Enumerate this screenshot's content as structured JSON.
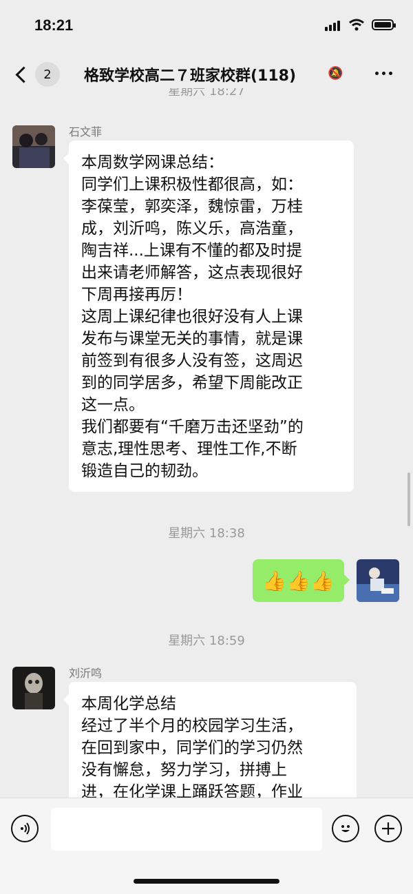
{
  "status_bar": {
    "time": "18:21"
  },
  "nav": {
    "back_count": "2",
    "title": "格致学校高二７班家校群(118)"
  },
  "timestamps": [
    "星期六 18:27",
    "星期六 18:38",
    "星期六 18:59"
  ],
  "messages": [
    {
      "sender": "石文菲",
      "lines": [
        "本周数学网课总结：",
        "同学们上课积极性都很高，如：",
        "李葆莹，郭奕泽，魏惊雷，万桂",
        "成，刘沂鸣，陈义乐，高浩童，",
        "陶吉祥...上课有不懂的都及时提",
        "出来请老师解答，这点表现很好",
        "下周再接再厉！",
        "这周上课纪律也很好没有人上课",
        "发布与课堂无关的事情，就是课",
        "前签到有很多人没有签，这周迟",
        "到的同学居多，希望下周能改正",
        "这一点。",
        "我们都要有“千磨万击还坚劲”的",
        "意志,理性思考、理性工作,不断",
        "锻造自己的韧劲。"
      ]
    },
    {
      "self_content": "👍👍👍"
    },
    {
      "sender": "刘沂鸣",
      "lines": [
        "本周化学总结",
        "经过了半个月的校园学习生活，",
        "在回到家中，同学们的学习仍然",
        "没有懈怠，努力学习，拼搏上",
        "进，在化学课上踊跃答题，作业"
      ]
    }
  ],
  "input_bar": {
    "voice_icon": "voice-icon",
    "emoji_icon": "emoji-icon",
    "plus_icon": "plus-icon"
  },
  "colors": {
    "background": "#ededed",
    "self_bubble": "#95ec69",
    "other_bubble": "#ffffff"
  }
}
